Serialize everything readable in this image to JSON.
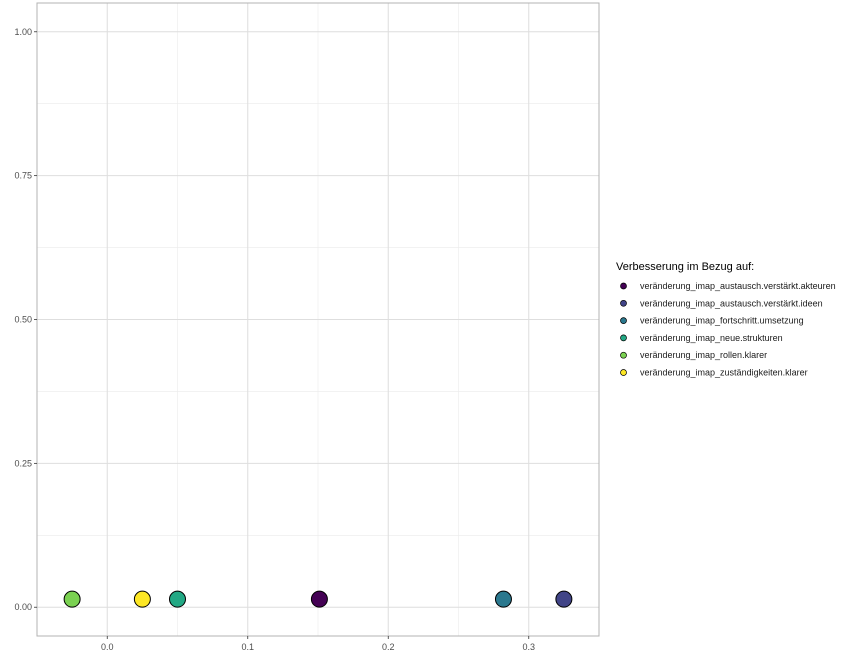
{
  "chart_data": {
    "type": "scatter",
    "title": "",
    "xlabel": "",
    "ylabel": "",
    "xlim": [
      -0.05,
      0.35
    ],
    "ylim": [
      -0.05,
      1.05
    ],
    "x_ticks": [
      "0.0",
      "0.1",
      "0.2",
      "0.3"
    ],
    "y_ticks": [
      "0.00",
      "0.25",
      "0.50",
      "0.75",
      "1.00"
    ],
    "grid": true,
    "legend": {
      "title": "Verbesserung im Bezug auf:",
      "position": "right"
    },
    "series": [
      {
        "name": "veränderung_imap_austausch.verstärkt.akteuren",
        "color": "#440154",
        "x": 0.151,
        "y": 0.014
      },
      {
        "name": "veränderung_imap_austausch.verstärkt.ideen",
        "color": "#414487",
        "x": 0.325,
        "y": 0.014
      },
      {
        "name": "veränderung_imap_fortschritt.umsetzung",
        "color": "#2A788E",
        "x": 0.282,
        "y": 0.014
      },
      {
        "name": "veränderung_imap_neue.strukturen",
        "color": "#22A884",
        "x": 0.05,
        "y": 0.014
      },
      {
        "name": "veränderung_imap_rollen.klarer",
        "color": "#7AD151",
        "x": -0.025,
        "y": 0.014
      },
      {
        "name": "veränderung_imap_zuständigkeiten.klarer",
        "color": "#FDE725",
        "x": 0.025,
        "y": 0.014
      }
    ]
  }
}
